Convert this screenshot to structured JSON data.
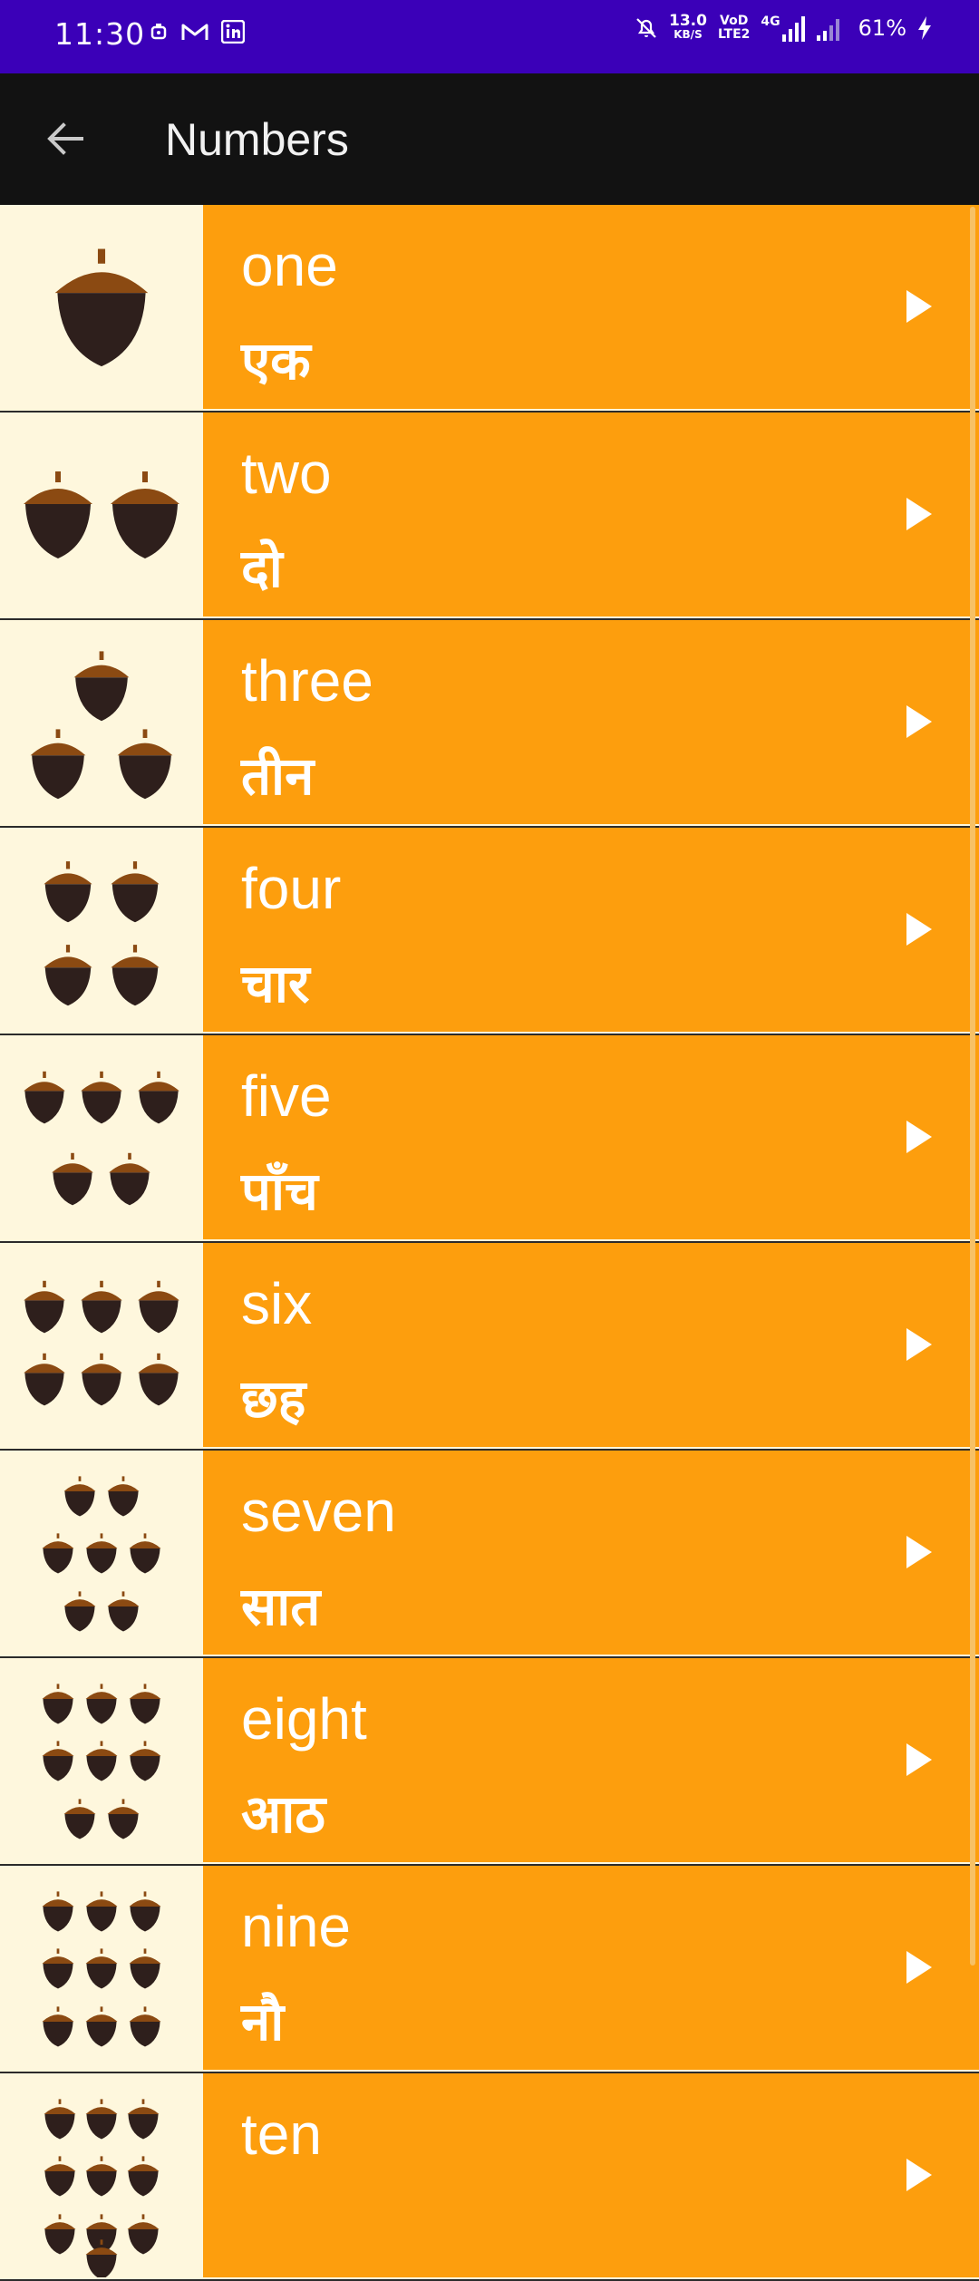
{
  "status_bar": {
    "time": "11:30",
    "net_speed_value": "13.0",
    "net_speed_unit": "KB/S",
    "volte_top": "VoD",
    "volte_bottom": "LTE2",
    "network_type": "4G",
    "battery": "61%",
    "icons": [
      "alarm-icon",
      "gmail-icon",
      "linkedin-icon",
      "mute-icon",
      "signal-icon",
      "charging-icon"
    ]
  },
  "app_bar": {
    "title": "Numbers",
    "back_icon": "arrow-left-icon"
  },
  "colors": {
    "status_bar": "#3b00b8",
    "app_bar": "#121212",
    "row_bg": "#fd9e0d",
    "thumb_bg": "#fef7dd",
    "acorn_cap": "#8b4a12",
    "acorn_body": "#2e1f1c"
  },
  "numbers": [
    {
      "english": "one",
      "hindi": "एक",
      "count": 1
    },
    {
      "english": "two",
      "hindi": "दो",
      "count": 2
    },
    {
      "english": "three",
      "hindi": "तीन",
      "count": 3
    },
    {
      "english": "four",
      "hindi": "चार",
      "count": 4
    },
    {
      "english": "five",
      "hindi": "पाँच",
      "count": 5
    },
    {
      "english": "six",
      "hindi": "छह",
      "count": 6
    },
    {
      "english": "seven",
      "hindi": "सात",
      "count": 7
    },
    {
      "english": "eight",
      "hindi": "आठ",
      "count": 8
    },
    {
      "english": "nine",
      "hindi": "नौ",
      "count": 9
    },
    {
      "english": "ten",
      "hindi": "",
      "count": 10
    }
  ]
}
